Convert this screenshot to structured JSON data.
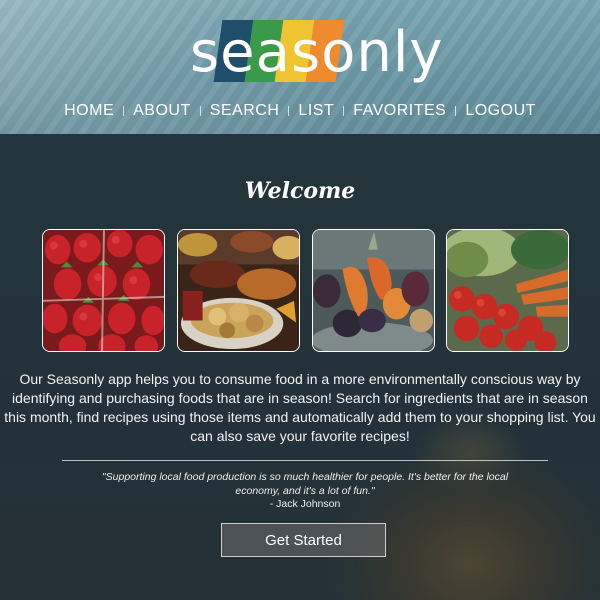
{
  "brand": {
    "name": "seasonly",
    "stripe_colors": [
      "#1f4e6b",
      "#3b9a4a",
      "#f0c431",
      "#f08a2e"
    ]
  },
  "nav": {
    "items": [
      "HOME",
      "ABOUT",
      "SEARCH",
      "LIST",
      "FAVORITES",
      "LOGOUT"
    ]
  },
  "main": {
    "heading": "Welcome",
    "photos": [
      "strawberries-photo",
      "food-buffet-photo",
      "root-vegetables-photo",
      "tomatoes-carrots-photo"
    ],
    "description": "Our Seasonly app helps you to consume food in a more environmentally conscious way by identifying and purchasing foods that are in season! Search for ingredients that are in season this month, find recipes using those items and automatically add them to your shopping list. You can also save your favorite recipes!",
    "quote": "\"Supporting local food production is so much healthier for people. It's better for the local economy, and it's a lot of fun.\"",
    "quote_author": "- Jack Johnson",
    "cta_label": "Get Started"
  }
}
